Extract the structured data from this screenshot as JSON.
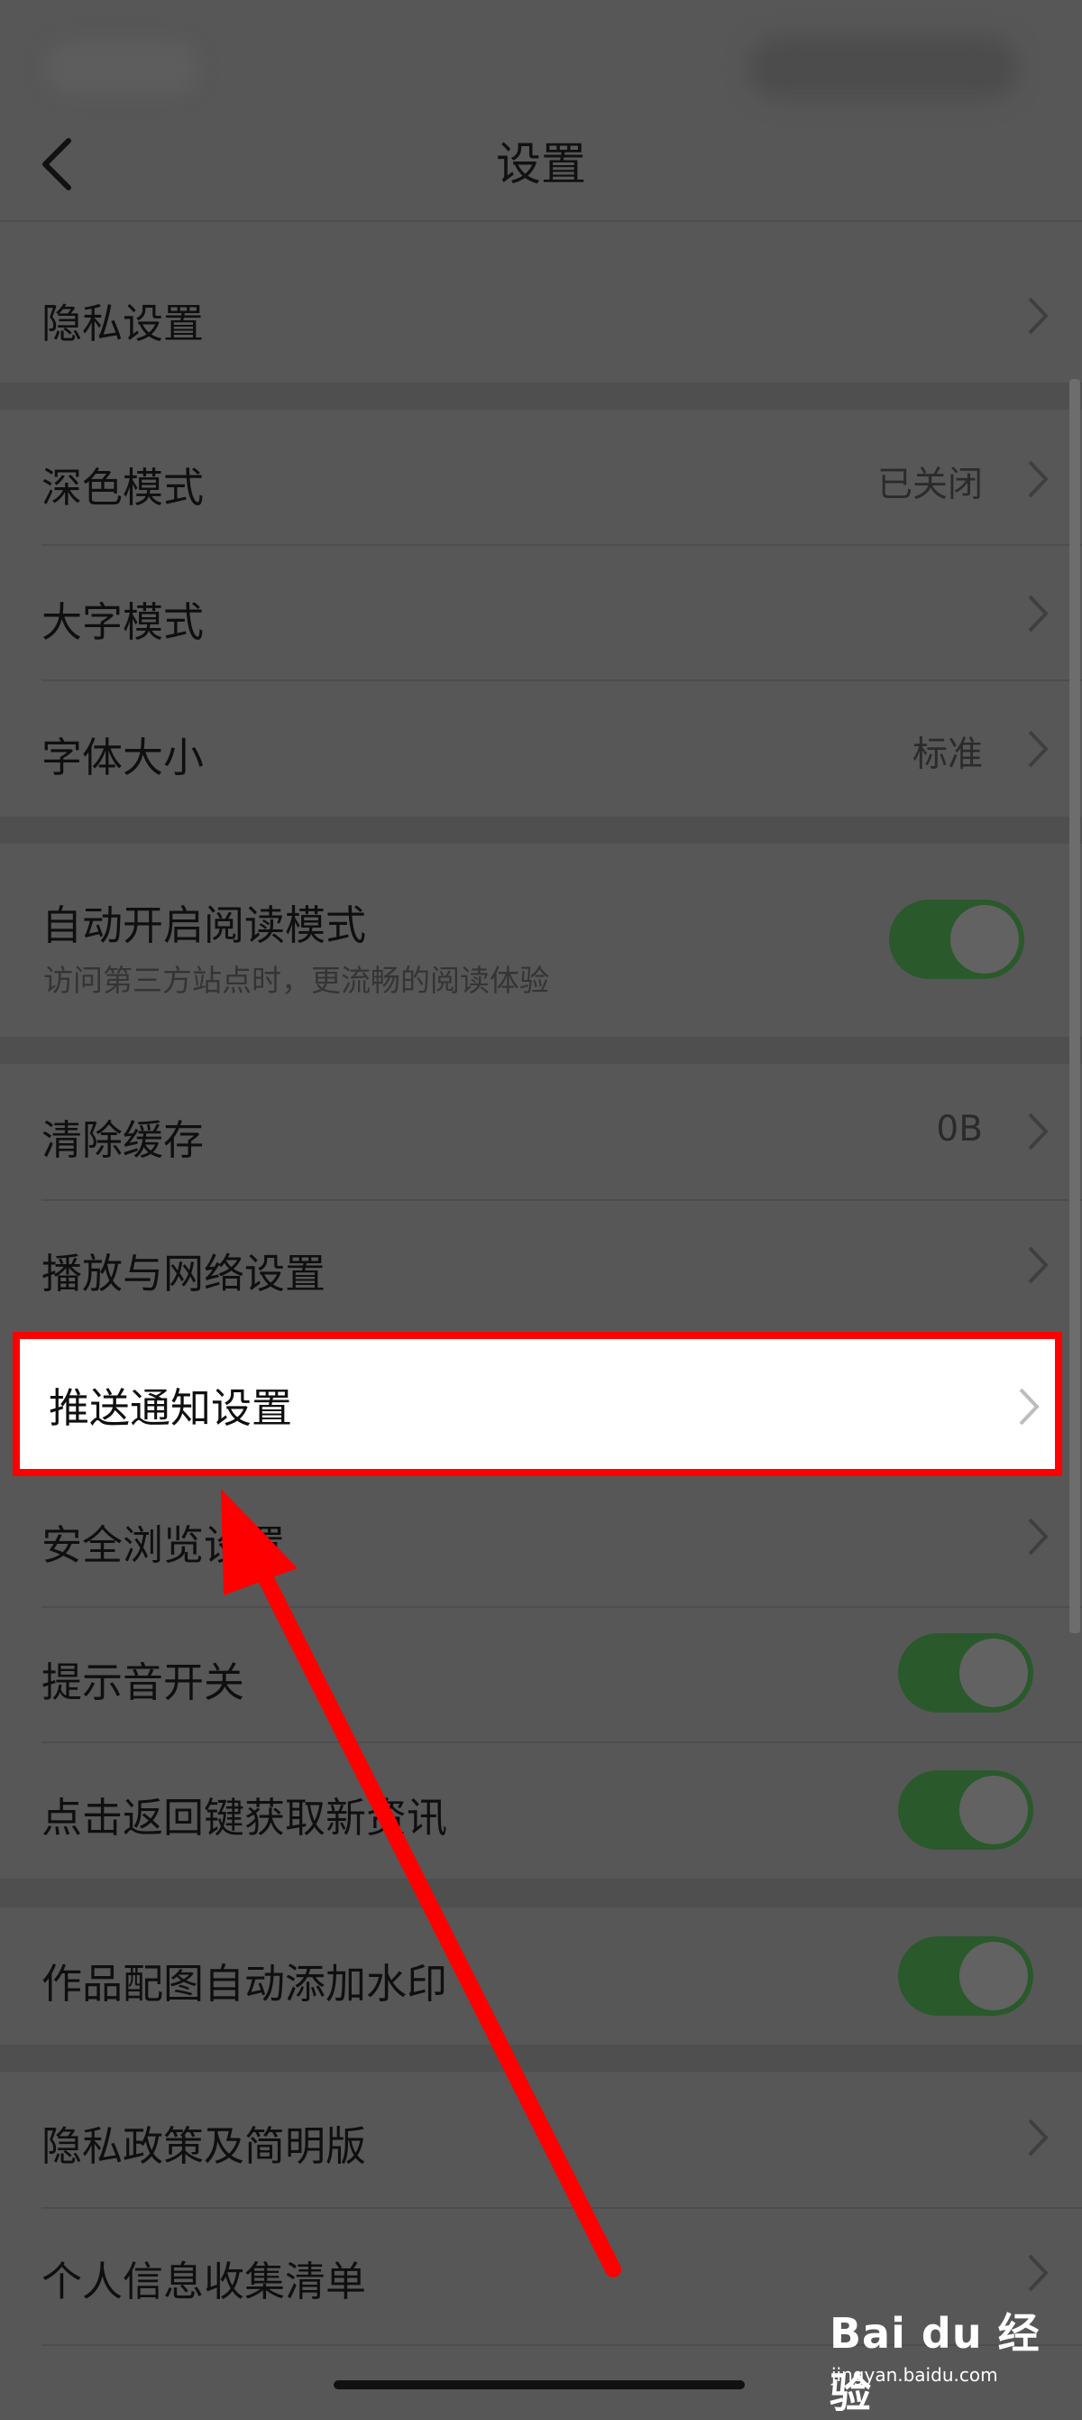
{
  "nav": {
    "title": "设置"
  },
  "rows": {
    "privacy": {
      "label": "隐私设置"
    },
    "dark_mode": {
      "label": "深色模式",
      "value": "已关闭"
    },
    "large_text": {
      "label": "大字模式"
    },
    "font_size": {
      "label": "字体大小",
      "value": "标准"
    },
    "reader_mode": {
      "label": "自动开启阅读模式",
      "sub": "访问第三方站点时，更流畅的阅读体验",
      "on": true
    },
    "clear_cache": {
      "label": "清除缓存",
      "value": "0B"
    },
    "playback_network": {
      "label": "播放与网络设置"
    },
    "push_notification": {
      "label": "推送通知设置"
    },
    "safe_browsing": {
      "label": "安全浏览设置"
    },
    "sound_toggle": {
      "label": "提示音开关",
      "on": true
    },
    "back_refresh": {
      "label": "点击返回键获取新资讯",
      "on": true
    },
    "watermark": {
      "label": "作品配图自动添加水印",
      "on": true
    },
    "privacy_policy": {
      "label": "隐私政策及简明版"
    },
    "personal_info": {
      "label": "个人信息收集清单"
    }
  },
  "watermark_logo": {
    "text": "Bai du 经验",
    "url": "jingyan.baidu.com"
  },
  "colors": {
    "overlay_bg": "#575757",
    "toggle_on": "#2a592c",
    "highlight": "#ff0000",
    "arrow": "#ff0000"
  }
}
